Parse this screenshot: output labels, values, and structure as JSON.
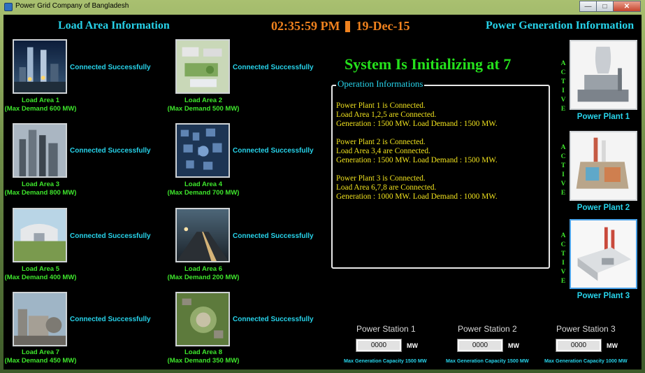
{
  "window": {
    "title": "Power Grid Company of Bangladesh",
    "icon": "app-icon"
  },
  "header": {
    "load_title": "Load Area Information",
    "gen_title": "Power Generation Information",
    "time": "02:35:59 PM",
    "date": "19-Dec-15"
  },
  "load_areas": [
    {
      "name": "Load Area 1",
      "demand": "(Max Demand 600 MW)",
      "status": "Connected Successfully"
    },
    {
      "name": "Load Area 2",
      "demand": "(Max Demand 500 MW)",
      "status": "Connected Successfully"
    },
    {
      "name": "Load Area 3",
      "demand": "(Max Demand 800 MW)",
      "status": "Connected Successfully"
    },
    {
      "name": "Load Area 4",
      "demand": "(Max Demand 700 MW)",
      "status": "Connected Successfully"
    },
    {
      "name": "Load Area 5",
      "demand": "(Max Demand 400 MW)",
      "status": "Connected Successfully"
    },
    {
      "name": "Load Area 6",
      "demand": "(Max Demand 200 MW)",
      "status": "Connected Successfully"
    },
    {
      "name": "Load Area 7",
      "demand": "(Max Demand 450 MW)",
      "status": "Connected Successfully"
    },
    {
      "name": "Load Area 8",
      "demand": "(Max Demand 350 MW)",
      "status": "Connected Successfully"
    }
  ],
  "init_message": "System Is Initializing at  7",
  "operation": {
    "title": "Operation Informations",
    "blocks": [
      [
        "Power Plant 1 is Connected.",
        "Load Area 1,2,5 are Connected.",
        "Generation : 1500 MW. Load Demand : 1500 MW."
      ],
      [
        "Power Plant 2 is Connected.",
        "Load Area 3,4 are Connected.",
        "Generation : 1500 MW. Load Demand : 1500 MW."
      ],
      [
        "Power Plant 3 is Connected.",
        "Load Area 6,7,8 are Connected.",
        "Generation : 1000 MW. Load Demand : 1000 MW."
      ]
    ]
  },
  "plants": [
    {
      "name": "Power Plant 1",
      "state": [
        "A",
        "C",
        "T",
        "I",
        "V",
        "E"
      ]
    },
    {
      "name": "Power Plant 2",
      "state": [
        "A",
        "C",
        "T",
        "I",
        "V",
        "E"
      ]
    },
    {
      "name": "Power Plant 3",
      "state": [
        "A",
        "C",
        "T",
        "I",
        "V",
        "E"
      ]
    }
  ],
  "stations": [
    {
      "title": "Power Station 1",
      "value": "0000",
      "unit": "MW",
      "capacity": "Max Generation Capacity  1500 MW"
    },
    {
      "title": "Power Station 2",
      "value": "0000",
      "unit": "MW",
      "capacity": "Max Generation Capacity  1500 MW"
    },
    {
      "title": "Power Station 3",
      "value": "0000",
      "unit": "MW",
      "capacity": "Max Generation Capacity  1000 MW"
    }
  ],
  "colors": {
    "cyan": "#27d3ea",
    "green": "#3ee62c",
    "yellow": "#f0e21e",
    "orange": "#f0821e"
  }
}
